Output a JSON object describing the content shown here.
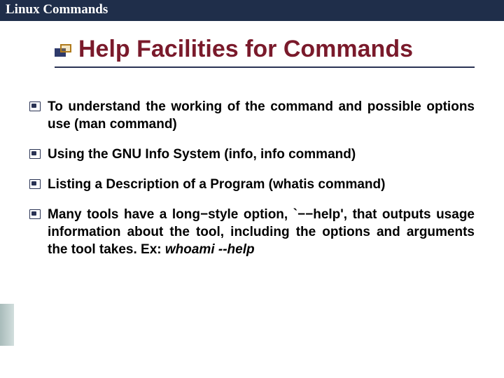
{
  "header": {
    "title": "Linux Commands"
  },
  "slide": {
    "title": "Help Facilities for Commands",
    "bullets": [
      {
        "text": "To understand the working of the command and possible options use (man command)",
        "justify": true
      },
      {
        "text": "Using the GNU Info System (info, info command)",
        "justify": false
      },
      {
        "text": "Listing a Description of a Program (whatis command)",
        "justify": false
      },
      {
        "text": "Many tools have a long−style option, `−−help', that outputs usage information about the tool, including the options and arguments the tool takes. Ex: ",
        "justify": true,
        "example": "whoami --help"
      }
    ]
  }
}
